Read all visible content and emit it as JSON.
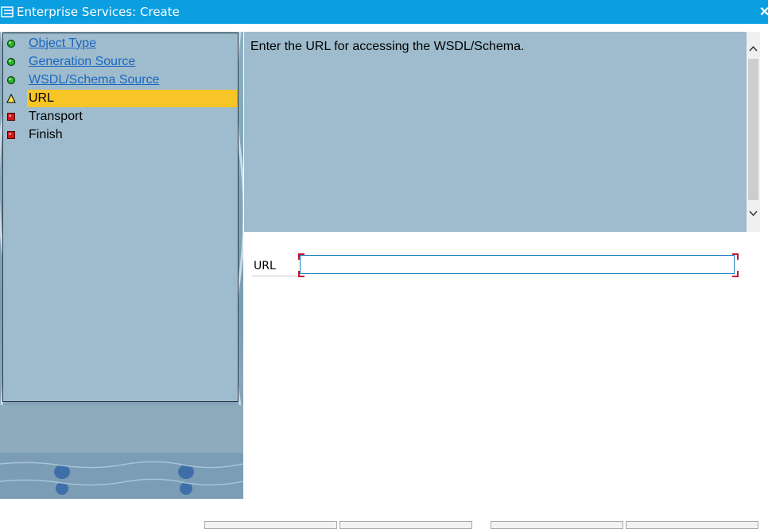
{
  "window": {
    "title": "Enterprise Services: Create",
    "icons": {
      "app": "window-menu-icon",
      "close": "close-icon"
    },
    "title_color": "#0b9ee0"
  },
  "steps": [
    {
      "label": "Object Type",
      "status": "done",
      "icon": "green-dot-icon",
      "is_link": true
    },
    {
      "label": "Generation Source",
      "status": "done",
      "icon": "green-dot-icon",
      "is_link": true
    },
    {
      "label": "WSDL/Schema Source",
      "status": "done",
      "icon": "green-dot-icon",
      "is_link": true
    },
    {
      "label": "URL",
      "status": "current",
      "icon": "yellow-triangle-icon",
      "is_link": false
    },
    {
      "label": "Transport",
      "status": "pending",
      "icon": "red-square-icon",
      "is_link": false
    },
    {
      "label": "Finish",
      "status": "pending",
      "icon": "red-square-icon",
      "is_link": false
    }
  ],
  "info": {
    "message": "Enter the URL for accessing the WSDL/Schema."
  },
  "form": {
    "url_label": "URL",
    "url_value": "",
    "url_placeholder": ""
  },
  "colors": {
    "panel": "#9ebccd",
    "current_step": "#f8c526",
    "link": "#1a66c0"
  }
}
